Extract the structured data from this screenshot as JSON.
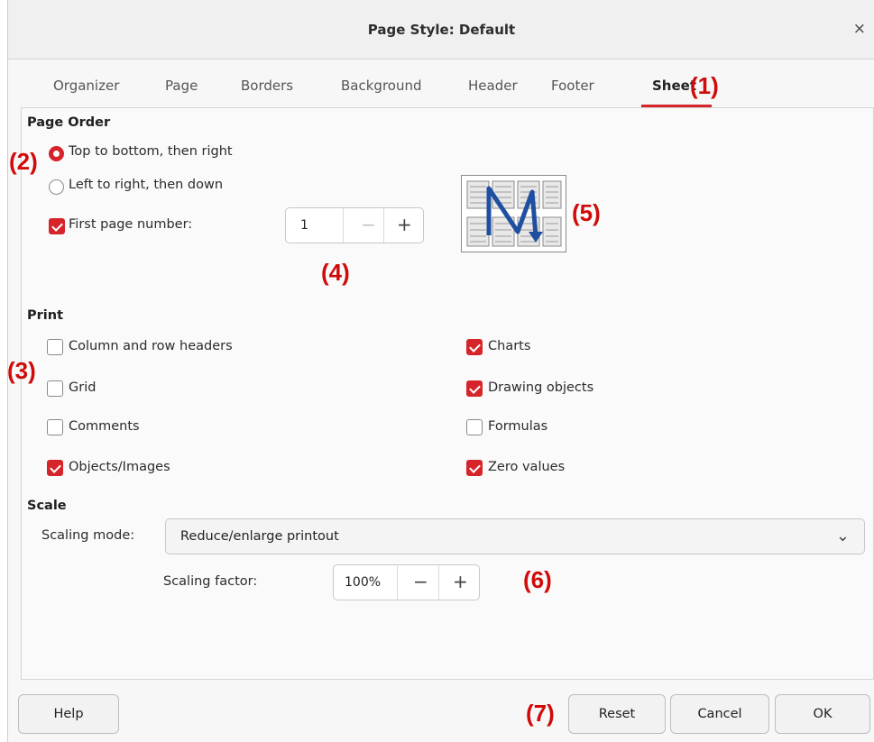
{
  "dialog": {
    "title": "Page Style: Default",
    "close": "×"
  },
  "tabs": [
    "Organizer",
    "Page",
    "Borders",
    "Background",
    "Header",
    "Footer",
    "Sheet"
  ],
  "active_tab": "Sheet",
  "page_order": {
    "title": "Page Order",
    "options": [
      {
        "label": "Top to bottom, then right",
        "selected": true
      },
      {
        "label": "Left to right, then down",
        "selected": false
      }
    ],
    "first_page_number": {
      "label": "First page number:",
      "checked": true,
      "value": "1"
    }
  },
  "print": {
    "title": "Print",
    "left": [
      {
        "label": "Column and row headers",
        "checked": false
      },
      {
        "label": "Grid",
        "checked": false
      },
      {
        "label": "Comments",
        "checked": false
      },
      {
        "label": "Objects/Images",
        "checked": true
      }
    ],
    "right": [
      {
        "label": "Charts",
        "checked": true
      },
      {
        "label": "Drawing objects",
        "checked": true
      },
      {
        "label": "Formulas",
        "checked": false
      },
      {
        "label": "Zero values",
        "checked": true
      }
    ]
  },
  "scale": {
    "title": "Scale",
    "mode_label": "Scaling mode:",
    "mode_value": "Reduce/enlarge printout",
    "factor_label": "Scaling factor:",
    "factor_value": "100%"
  },
  "spin_symbols": {
    "minus": "−",
    "plus": "+"
  },
  "buttons": {
    "help": "Help",
    "reset": "Reset",
    "cancel": "Cancel",
    "ok": "OK"
  },
  "annotations": {
    "a1": "(1)",
    "a2": "(2)",
    "a3": "(3)",
    "a4": "(4)",
    "a5": "(5)",
    "a6": "(6)",
    "a7": "(7)"
  },
  "colors": {
    "accent": "#d6242b",
    "annotation": "#d10a0a",
    "diagram_arrow": "#1f4fa0"
  }
}
